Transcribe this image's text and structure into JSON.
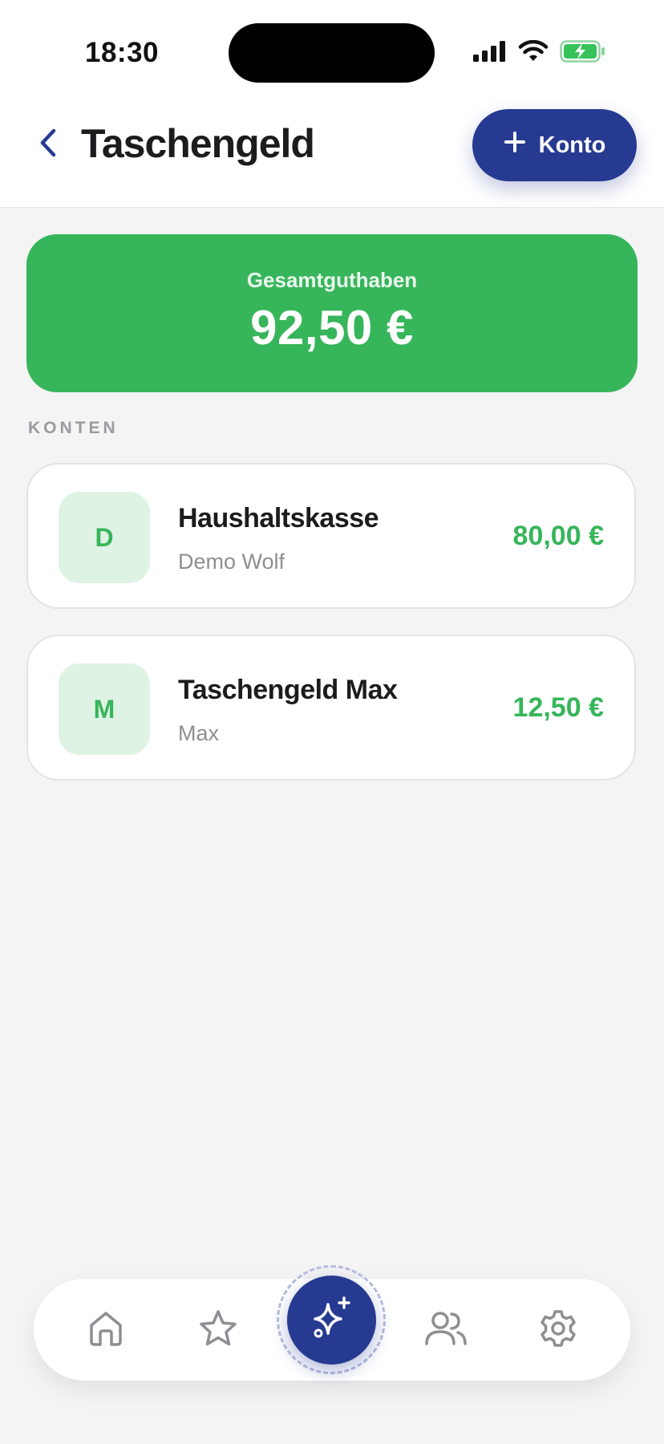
{
  "status_bar": {
    "time": "18:30"
  },
  "header": {
    "title": "Taschengeld",
    "add_button_label": "Konto"
  },
  "summary": {
    "label": "Gesamtguthaben",
    "amount": "92,50 €"
  },
  "accounts_section": {
    "label": "KONTEN",
    "items": [
      {
        "initial": "D",
        "name": "Haushaltskasse",
        "owner": "Demo Wolf",
        "balance": "80,00 €"
      },
      {
        "initial": "M",
        "name": "Taschengeld Max",
        "owner": "Max",
        "balance": "12,50 €"
      }
    ]
  },
  "bottom_nav": {
    "items": [
      {
        "icon": "home-icon"
      },
      {
        "icon": "star-icon"
      },
      {
        "icon": "sparkles-icon"
      },
      {
        "icon": "users-icon"
      },
      {
        "icon": "gear-icon"
      }
    ]
  },
  "colors": {
    "accent": "#263a91",
    "success": "#37b55a",
    "background": "#f4f4f5"
  }
}
